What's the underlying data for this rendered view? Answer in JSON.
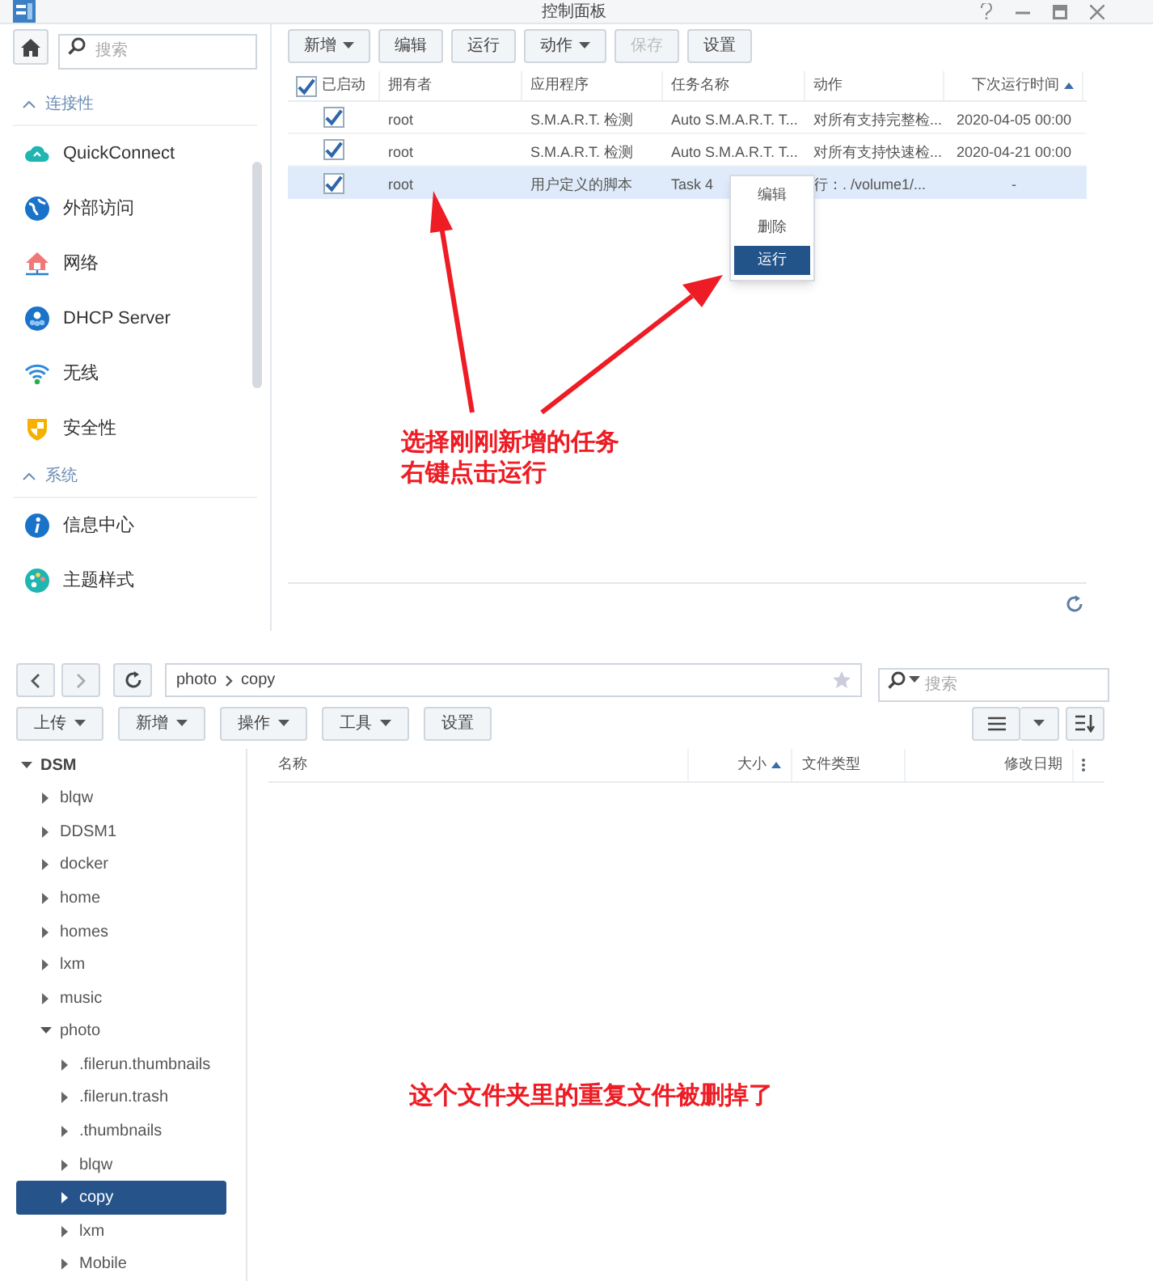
{
  "window": {
    "title": "控制面板"
  },
  "sidebar": {
    "search_placeholder": "搜索",
    "items": [
      {
        "kind": "header",
        "label": "连接性"
      },
      {
        "kind": "item",
        "label": "QuickConnect"
      },
      {
        "kind": "item",
        "label": "外部访问"
      },
      {
        "kind": "item",
        "label": "网络"
      },
      {
        "kind": "item",
        "label": "DHCP Server"
      },
      {
        "kind": "item",
        "label": "无线"
      },
      {
        "kind": "item",
        "label": "安全性"
      },
      {
        "kind": "header",
        "label": "系统"
      },
      {
        "kind": "item",
        "label": "信息中心"
      },
      {
        "kind": "item",
        "label": "主题样式"
      }
    ]
  },
  "toolbar": [
    {
      "label": "新增",
      "dropdown": true,
      "disabled": false
    },
    {
      "label": "编辑",
      "dropdown": false,
      "disabled": false
    },
    {
      "label": "运行",
      "dropdown": false,
      "disabled": false
    },
    {
      "label": "动作",
      "dropdown": true,
      "disabled": false
    },
    {
      "label": "保存",
      "dropdown": false,
      "disabled": true
    },
    {
      "label": "设置",
      "dropdown": false,
      "disabled": false
    }
  ],
  "table": {
    "all_checked": true,
    "enabled_column": "已启动",
    "columns": [
      {
        "label": "拥有者",
        "sorted": false
      },
      {
        "label": "应用程序",
        "sorted": false
      },
      {
        "label": "任务名称",
        "sorted": false
      },
      {
        "label": "动作",
        "sorted": false
      },
      {
        "label": "下次运行时间",
        "sorted": true
      }
    ],
    "rows": [
      {
        "enabled": true,
        "selected": false,
        "cells": [
          "root",
          "S.M.A.R.T. 检测",
          "Auto S.M.A.R.T. T...",
          "对所有支持完整检...",
          "2020-04-05 00:00"
        ]
      },
      {
        "enabled": true,
        "selected": false,
        "cells": [
          "root",
          "S.M.A.R.T. 检测",
          "Auto S.M.A.R.T. T...",
          "对所有支持快速检...",
          "2020-04-21 00:00"
        ]
      },
      {
        "enabled": true,
        "selected": true,
        "cells": [
          "root",
          "用户定义的脚本",
          "Task 4",
          "行：. /volume1/...",
          "-"
        ]
      }
    ]
  },
  "context_menu": [
    {
      "label": "编辑",
      "selected": false
    },
    {
      "label": "删除",
      "selected": false
    },
    {
      "label": "运行",
      "selected": true
    }
  ],
  "annotation_top": [
    "选择刚刚新增的任务",
    "右键点击运行"
  ],
  "file_station": {
    "path": [
      "photo",
      "copy"
    ],
    "search_placeholder": "搜索",
    "toolbar": [
      {
        "label": "上传",
        "dropdown": true
      },
      {
        "label": "新增",
        "dropdown": true
      },
      {
        "label": "操作",
        "dropdown": true
      },
      {
        "label": "工具",
        "dropdown": true
      },
      {
        "label": "设置",
        "dropdown": false
      }
    ],
    "columns": [
      {
        "label": "名称",
        "sorted": false
      },
      {
        "label": "大小",
        "sorted": true
      },
      {
        "label": "文件类型",
        "sorted": false
      },
      {
        "label": "修改日期",
        "sorted": false
      }
    ],
    "tree": [
      {
        "label": "DSM",
        "expanded": true,
        "selected": false,
        "children": [
          {
            "label": "blqw",
            "expanded": false,
            "selected": false
          },
          {
            "label": "DDSM1",
            "expanded": false,
            "selected": false
          },
          {
            "label": "docker",
            "expanded": false,
            "selected": false
          },
          {
            "label": "home",
            "expanded": false,
            "selected": false
          },
          {
            "label": "homes",
            "expanded": false,
            "selected": false
          },
          {
            "label": "lxm",
            "expanded": false,
            "selected": false
          },
          {
            "label": "music",
            "expanded": false,
            "selected": false
          },
          {
            "label": "photo",
            "expanded": true,
            "selected": false,
            "children": [
              {
                "label": ".filerun.thumbnails",
                "expanded": false,
                "selected": false
              },
              {
                "label": ".filerun.trash",
                "expanded": false,
                "selected": false
              },
              {
                "label": ".thumbnails",
                "expanded": false,
                "selected": false
              },
              {
                "label": "blqw",
                "expanded": false,
                "selected": false
              },
              {
                "label": "copy",
                "expanded": false,
                "selected": true
              },
              {
                "label": "lxm",
                "expanded": false,
                "selected": false
              },
              {
                "label": "Mobile",
                "expanded": false,
                "selected": false
              }
            ]
          }
        ]
      }
    ]
  },
  "annotation_bottom": "这个文件夹里的重复文件被删掉了"
}
